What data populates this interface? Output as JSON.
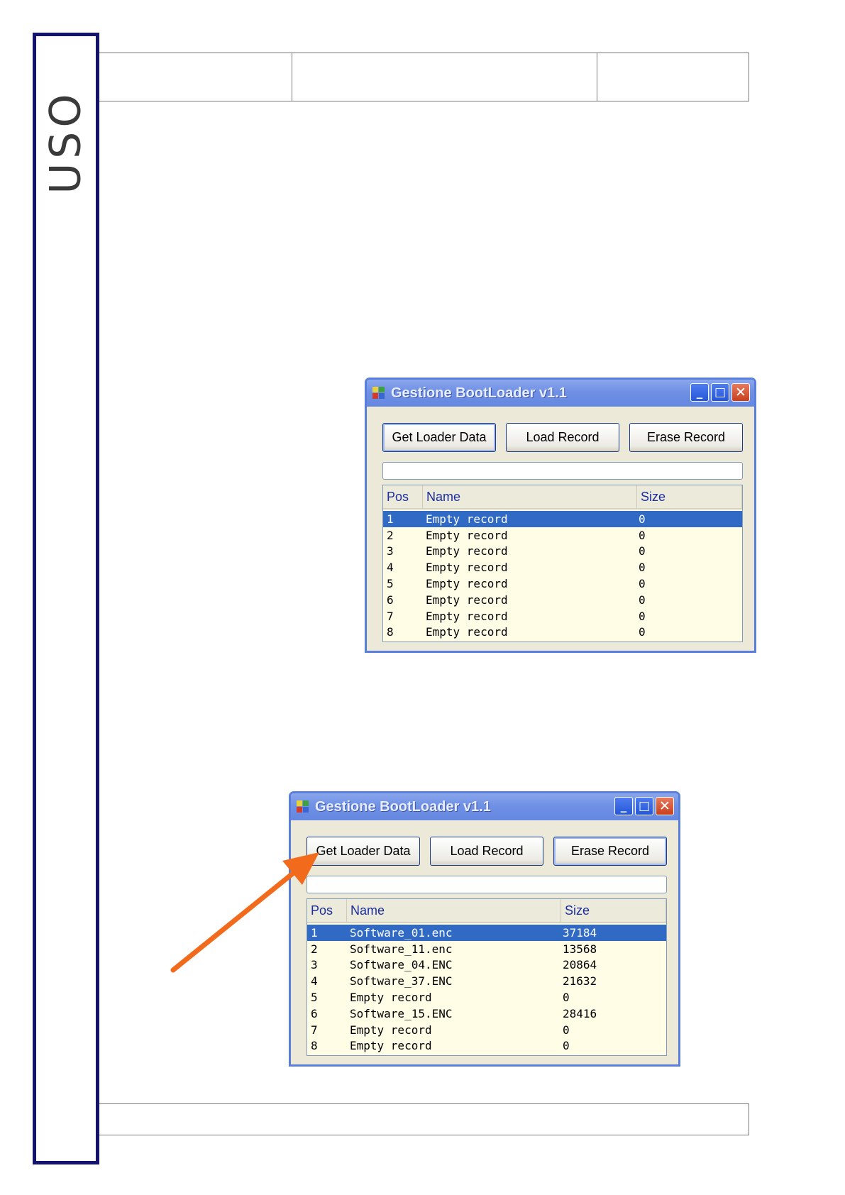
{
  "side": {
    "label": "USO"
  },
  "windows": [
    {
      "title": "Gestione BootLoader v1.1",
      "buttons": [
        "Get Loader Data",
        "Load Record",
        "Erase Record"
      ],
      "columns": [
        "Pos",
        "Name",
        "Size"
      ],
      "rows": [
        {
          "pos": "1",
          "name": "Empty record",
          "size": "0",
          "selected": true
        },
        {
          "pos": "2",
          "name": "Empty record",
          "size": "0"
        },
        {
          "pos": "3",
          "name": "Empty record",
          "size": "0"
        },
        {
          "pos": "4",
          "name": "Empty record",
          "size": "0"
        },
        {
          "pos": "5",
          "name": "Empty record",
          "size": "0"
        },
        {
          "pos": "6",
          "name": "Empty record",
          "size": "0"
        },
        {
          "pos": "7",
          "name": "Empty record",
          "size": "0"
        },
        {
          "pos": "8",
          "name": "Empty record",
          "size": "0"
        }
      ]
    },
    {
      "title": "Gestione BootLoader v1.1",
      "buttons": [
        "Get Loader Data",
        "Load Record",
        "Erase Record"
      ],
      "columns": [
        "Pos",
        "Name",
        "Size"
      ],
      "rows": [
        {
          "pos": "1",
          "name": "Software_01.enc",
          "size": "37184",
          "selected": true
        },
        {
          "pos": "2",
          "name": "Software_11.enc",
          "size": "13568"
        },
        {
          "pos": "3",
          "name": "Software_04.ENC",
          "size": "20864"
        },
        {
          "pos": "4",
          "name": "Software_37.ENC",
          "size": "21632"
        },
        {
          "pos": "5",
          "name": "Empty record",
          "size": "0"
        },
        {
          "pos": "6",
          "name": "Software_15.ENC",
          "size": "28416"
        },
        {
          "pos": "7",
          "name": "Empty record",
          "size": "0"
        },
        {
          "pos": "8",
          "name": "Empty record",
          "size": "0"
        }
      ]
    }
  ],
  "colors": {
    "side_border": "#14146e",
    "title_bar": "#6f90e4",
    "selection": "#316ac5",
    "list_background": "#fffde6",
    "arrow": "#f26a1b"
  },
  "icons": {
    "window_minimize": "minimize-icon",
    "window_maximize": "maximize-icon",
    "window_close": "close-icon",
    "annotation": "arrow-icon"
  }
}
